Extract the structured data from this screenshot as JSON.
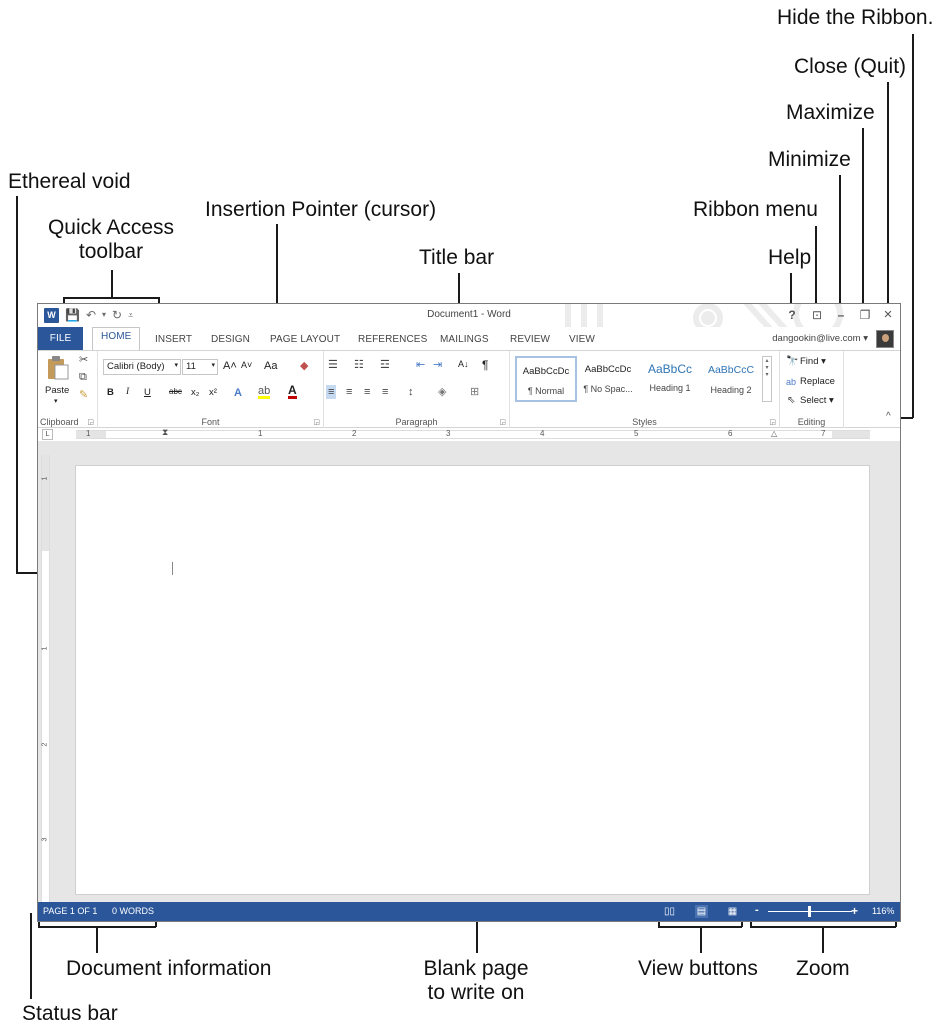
{
  "callouts": {
    "hide_ribbon": "Hide the Ribbon.",
    "close": "Close (Quit)",
    "maximize": "Maximize",
    "minimize": "Minimize",
    "ethereal_void": "Ethereal void",
    "insertion_pointer": "Insertion Pointer (cursor)",
    "ribbon_menu": "Ribbon menu",
    "quick_access_line1": "Quick Access",
    "quick_access_line2": "toolbar",
    "title_bar": "Title bar",
    "help": "Help",
    "document_information": "Document information",
    "blank_page_line1": "Blank page",
    "blank_page_line2": "to write on",
    "view_buttons": "View buttons",
    "zoom": "Zoom",
    "status_bar": "Status bar"
  },
  "window": {
    "title": "Document1 - Word",
    "app_icon": "W",
    "qat": {
      "save_icon": "save-icon",
      "undo_icon": "undo-icon",
      "redo_icon": "redo-icon",
      "customize_icon": "customize-icon"
    },
    "controls": {
      "help": "?",
      "ribbon_options": "⊡",
      "minimize": "–",
      "restore": "❐",
      "close": "×",
      "collapse": "^"
    },
    "account": "dangookin@live.com ▾",
    "accent_color": "#2b579a"
  },
  "tabs": [
    "FILE",
    "HOME",
    "INSERT",
    "DESIGN",
    "PAGE LAYOUT",
    "REFERENCES",
    "MAILINGS",
    "REVIEW",
    "VIEW"
  ],
  "ribbon": {
    "clipboard": {
      "label": "Clipboard",
      "paste": "Paste"
    },
    "font": {
      "label": "Font",
      "font_name": "Calibri (Body)",
      "font_size": "11",
      "bold": "B",
      "italic": "I",
      "underline": "U",
      "strike": "abc",
      "subscript": "x₂",
      "superscript": "x²",
      "grow": "A˄",
      "shrink": "A˅",
      "case": "Aa",
      "color_a": "A"
    },
    "paragraph": {
      "label": "Paragraph",
      "show_marks": "¶",
      "sort": "A↓"
    },
    "styles": {
      "label": "Styles",
      "items": [
        {
          "preview": "AaBbCcDc",
          "name": "¶ Normal"
        },
        {
          "preview": "AaBbCcDc",
          "name": "¶ No Spac..."
        },
        {
          "preview": "AaBbCc",
          "name": "Heading 1"
        },
        {
          "preview": "AaBbCcC",
          "name": "Heading 2"
        }
      ]
    },
    "editing": {
      "label": "Editing",
      "find": "Find ▾",
      "replace": "Replace",
      "select": "Select ▾"
    }
  },
  "ruler": {
    "numbers": [
      "1",
      "1",
      "2",
      "3",
      "4",
      "5",
      "6",
      "7"
    ],
    "tab_selector": "L"
  },
  "vruler": {
    "numbers": [
      "1",
      "1",
      "2",
      "3"
    ]
  },
  "status": {
    "page": "PAGE 1 OF 1",
    "words": "0 WORDS",
    "zoom_minus": "-",
    "zoom_plus": "+",
    "zoom_level": "116%"
  }
}
